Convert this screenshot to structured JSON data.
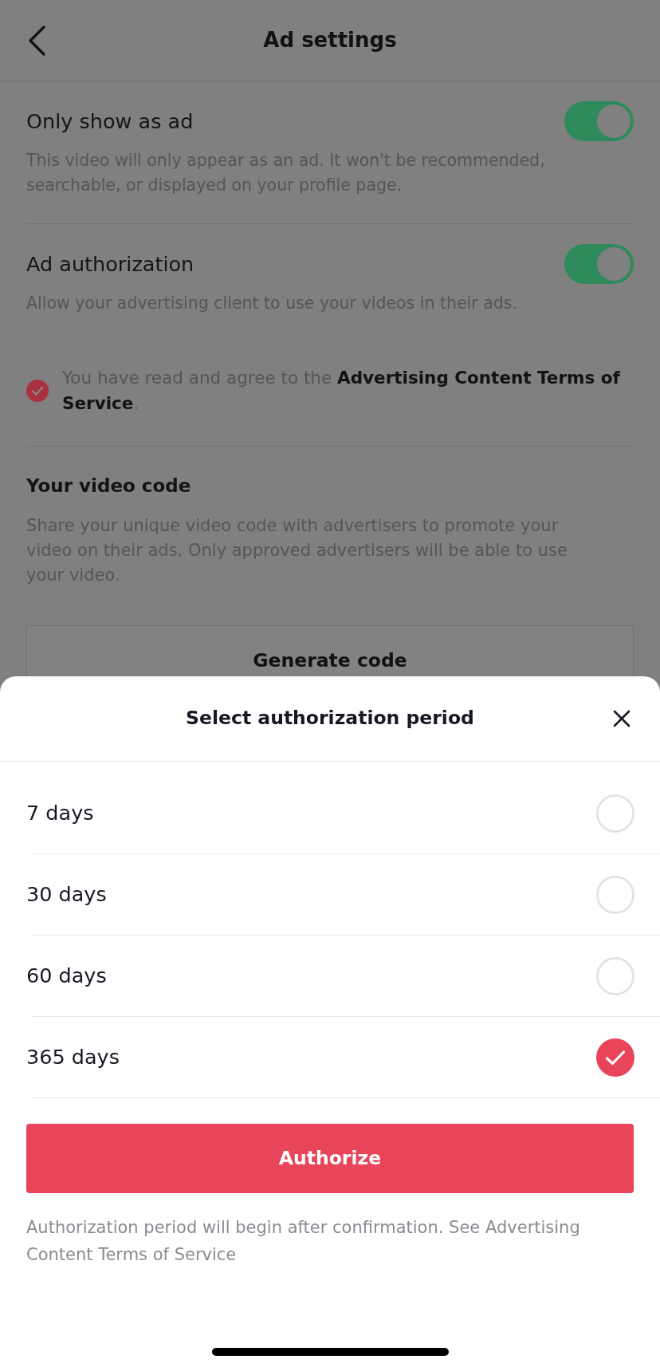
{
  "header": {
    "title": "Ad settings"
  },
  "settings": [
    {
      "label": "Only show as ad",
      "on": true,
      "description": "This video will only appear as an ad. It won't be recommended, searchable, or displayed on your profile page."
    },
    {
      "label": "Ad authorization",
      "on": true,
      "description": "Allow your advertising client to use your videos in their ads."
    }
  ],
  "agreement": {
    "checked": true,
    "text": "You have read and agree to the **Advertising Content Terms of Service**."
  },
  "video_code": {
    "title": "Your video code",
    "description": "Share your unique video code with advertisers to promote your video on their ads. Only approved advertisers will be able to use your video.",
    "button": "Generate code"
  },
  "sheet": {
    "title": "Select authorization period",
    "options": [
      {
        "label": "7 days",
        "selected": false
      },
      {
        "label": "30 days",
        "selected": false
      },
      {
        "label": "60 days",
        "selected": false
      },
      {
        "label": "365 days",
        "selected": true
      }
    ],
    "button": "Authorize",
    "note": "Authorization period will begin after confirmation. See Advertising Content Terms of Service"
  }
}
